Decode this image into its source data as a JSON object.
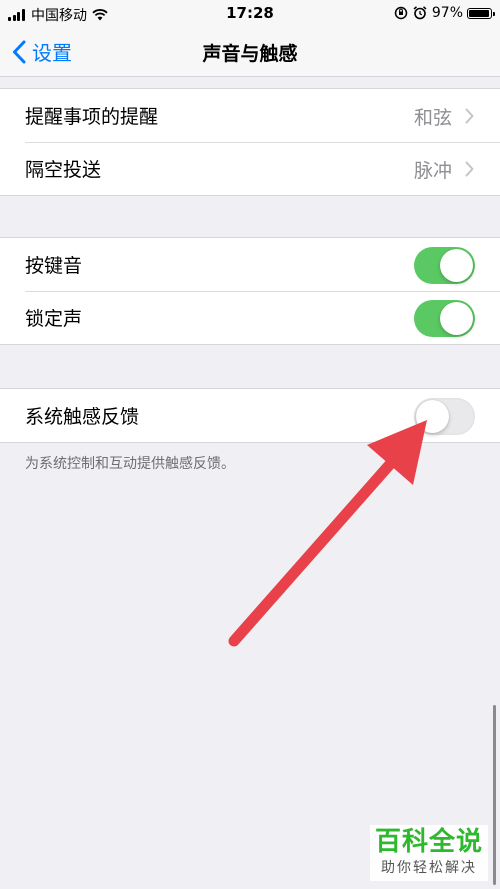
{
  "status_bar": {
    "carrier": "中国移动",
    "time": "17:28",
    "battery": "97%",
    "battery_level": 0.97
  },
  "nav": {
    "back_label": "设置",
    "title": "声音与触感"
  },
  "group1": [
    {
      "label": "提醒事项的提醒",
      "value": "和弦"
    },
    {
      "label": "隔空投送",
      "value": "脉冲"
    }
  ],
  "group2": [
    {
      "label": "按键音",
      "on": true
    },
    {
      "label": "锁定声",
      "on": true
    }
  ],
  "group3": {
    "label": "系统触感反馈",
    "on": false,
    "footer": "为系统控制和互动提供触感反馈。"
  },
  "watermark": {
    "title": "百科全说",
    "subtitle": "助你轻松解决"
  },
  "colors": {
    "accent": "#007aff",
    "toggle_on": "#5ac963",
    "arrow": "#e8414a"
  }
}
